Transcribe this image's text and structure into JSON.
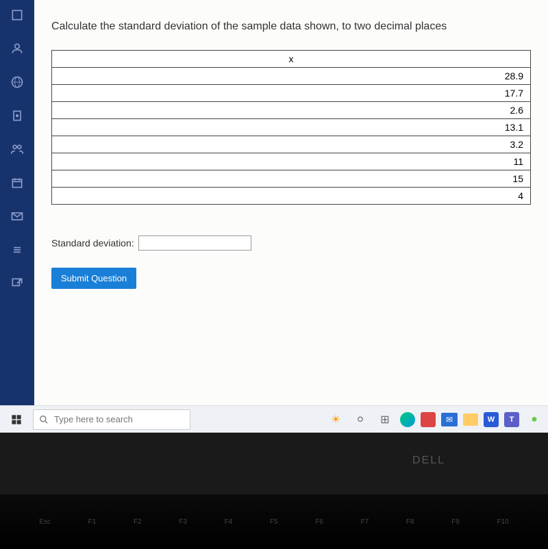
{
  "question": {
    "prompt": "Calculate the standard deviation of the sample data shown, to two decimal places",
    "table_header": "x",
    "data_values": [
      "28.9",
      "17.7",
      "2.6",
      "13.1",
      "3.2",
      "11",
      "15",
      "4"
    ],
    "answer_label": "Standard deviation:",
    "answer_value": "",
    "submit_label": "Submit Question"
  },
  "taskbar": {
    "search_placeholder": "Type here to search"
  },
  "branding": {
    "laptop": "DELL"
  },
  "keyboard": {
    "keys": [
      "Esc",
      "F1",
      "F2",
      "F3",
      "F4",
      "F5",
      "F6",
      "F7",
      "F8",
      "F9",
      "F10"
    ]
  }
}
